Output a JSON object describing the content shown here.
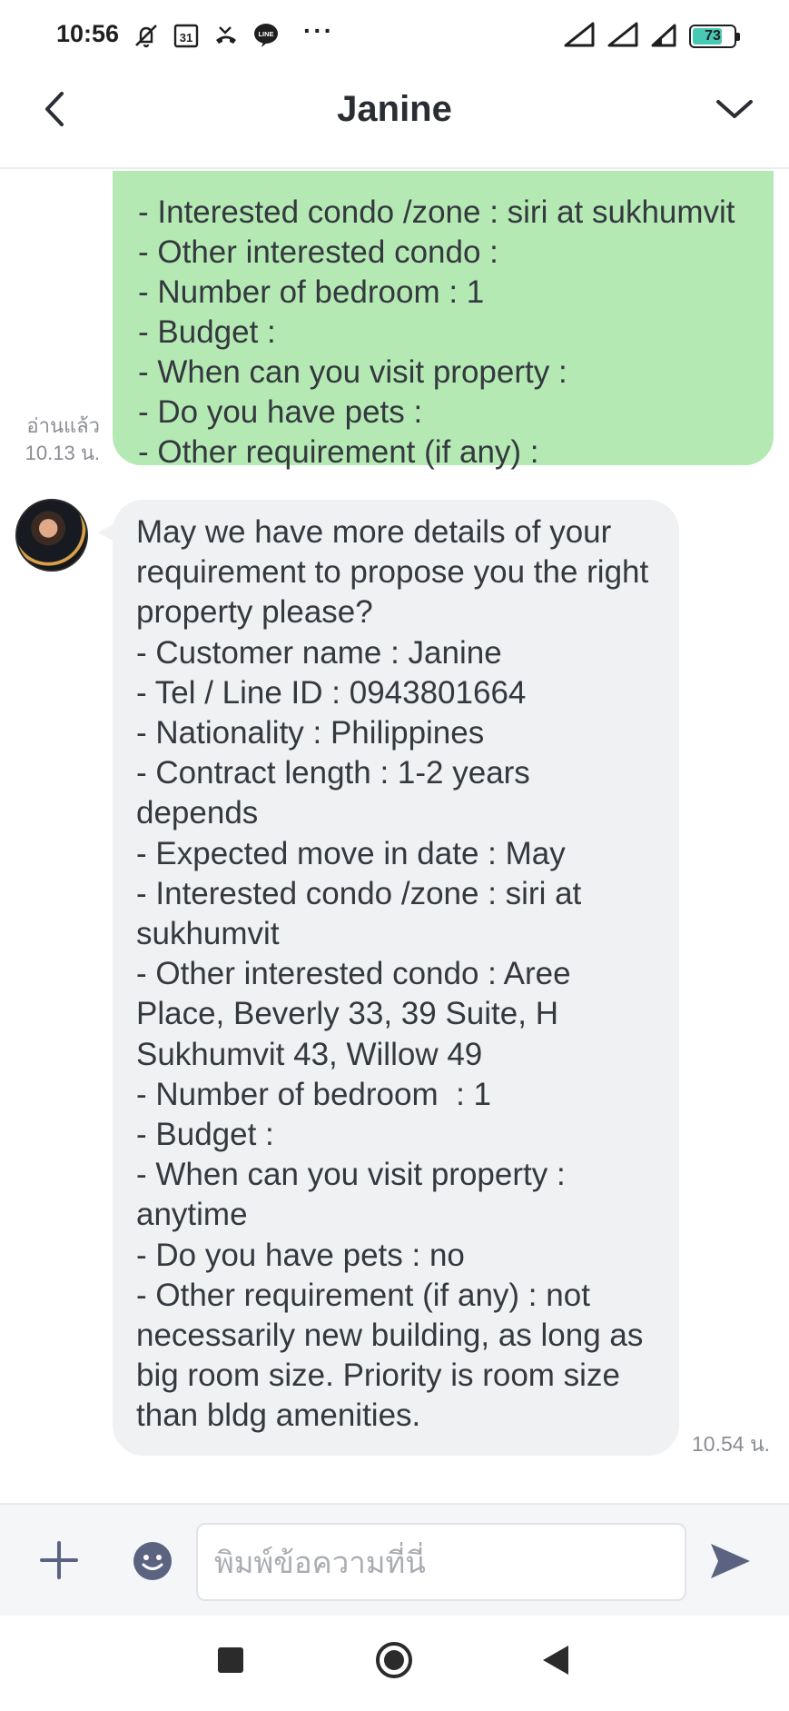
{
  "status_bar": {
    "time": "10:56",
    "icons_left": [
      "dnd-off-icon",
      "calendar-31-icon",
      "missed-call-icon",
      "line-app-icon"
    ],
    "calendar_day": "31",
    "line_badge": "LINE",
    "more": "···",
    "battery_percent": "73",
    "battery_level": 0.73,
    "icons_right": [
      "signal-icon",
      "signal-icon",
      "signal-weak-icon",
      "battery-icon"
    ]
  },
  "header": {
    "title": "Janine",
    "back_icon": "chevron-left-icon",
    "menu_icon": "chevron-down-icon"
  },
  "messages": {
    "sent": {
      "lines": [
        "- Interested condo /zone : siri at sukhumvit",
        "- Other interested condo :",
        "- Number of bedroom  : 1",
        "- Budget :",
        "- When can you visit property :",
        "- Do you have pets :",
        "- Other requirement (if any) :"
      ],
      "read_status": "อ่านแล้ว",
      "time": "10.13 น."
    },
    "received": {
      "text": "May we have more details of your requirement to propose you the right property please?\n- Customer name : Janine\n- Tel / Line ID : 0943801664\n- Nationality : Philippines\n- Contract length : 1-2 years depends\n- Expected move in date : May\n- Interested condo /zone : siri at sukhumvit\n- Other interested condo : Aree Place, Beverly 33, 39 Suite, H Sukhumvit 43, Willow 49\n- Number of bedroom  : 1\n- Budget :\n- When can you visit property : anytime\n- Do you have pets : no\n- Other requirement (if any) : not necessarily new building, as long as big room size. Priority is room size than bldg amenities.",
      "time": "10.54 น."
    }
  },
  "composer": {
    "placeholder": "พิมพ์ข้อความที่นี่",
    "value": "",
    "colors": {
      "icon": "#5b6381",
      "sent_bubble": "#b5e9b3",
      "received_bubble": "#f0f1f3"
    }
  }
}
